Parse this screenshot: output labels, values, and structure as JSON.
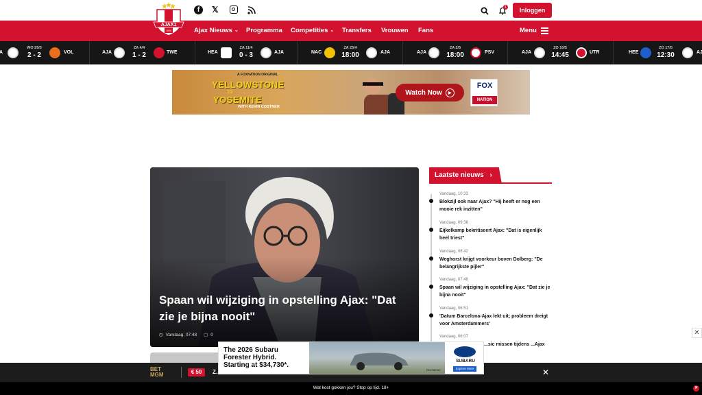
{
  "header": {
    "social": [
      "facebook-icon",
      "x-icon",
      "instagram-icon",
      "rss-icon"
    ],
    "notification_count": "1",
    "login_label": "Inloggen"
  },
  "logo": {
    "text": "AJAX1",
    "subtext": "1900"
  },
  "nav": {
    "items": [
      "Ajax Nieuws",
      "Programma",
      "Competities",
      "Transfers",
      "Vrouwen",
      "Fans"
    ],
    "menu_label": "Menu"
  },
  "scores": [
    {
      "home": "A",
      "away": "VOL",
      "date": "WO 25/3",
      "result": "2 - 2"
    },
    {
      "home": "AJA",
      "away": "TWE",
      "date": "ZA 4/4",
      "result": "1 - 2"
    },
    {
      "home": "HEA",
      "away": "AJA",
      "date": "ZA 11/4",
      "result": "0 - 3"
    },
    {
      "home": "NAC",
      "away": "AJA",
      "date": "ZA 25/4",
      "result": "18:00"
    },
    {
      "home": "AJA",
      "away": "PSV",
      "date": "ZA 2/5",
      "result": "18:00"
    },
    {
      "home": "AJA",
      "away": "UTR",
      "date": "ZO 10/5",
      "result": "14:45"
    },
    {
      "home": "HEE",
      "away": "AJ",
      "date": "ZO 17/5",
      "result": "12:30"
    }
  ],
  "banner_ad": {
    "brand": "A FOXNATION ORIGINAL",
    "line1": "YELLOWSTONE",
    "line2": "TO",
    "line3": "YOSEMITE",
    "line4": "WITH KEVIN COSTNER",
    "cta": "Watch Now",
    "logo_top": "FOX",
    "logo_bottom": "NATION"
  },
  "hero": {
    "title": "Spaan wil wijziging in opstelling Ajax: \"Dat zie je bijna nooit\"",
    "time": "Vandaag, 07:48",
    "comments": "0"
  },
  "latest": {
    "heading": "Laatste nieuws",
    "items": [
      {
        "time": "Vandaag, 10:33",
        "title": "Blokzijl ook naar Ajax? \"Hij heeft er nog een mooie rek inzitten\""
      },
      {
        "time": "Vandaag, 09:38",
        "title": "Eijkelkamp bekritiseert Ajax: \"Dat is eigenlijk heel triest\""
      },
      {
        "time": "Vandaag, 08:42",
        "title": "Weghorst krijgt voorkeur boven Dolberg: \"De belangrijkste pijler\""
      },
      {
        "time": "Vandaag, 07:48",
        "title": "Spaan wil wijziging in opstelling Ajax: \"Dat zie je bijna nooit\""
      },
      {
        "time": "Vandaag, 06:51",
        "title": "'Datum Barcelona-Ajax lekt uit; probleem dreigt voor Amsterdammers'"
      },
      {
        "time": "Vandaag, 06:07",
        "title": "...sic missen tijdens ...Ajax"
      }
    ]
  },
  "subaru_ad": {
    "copy_l1": "The 2026 Subaru",
    "copy_l2": "Forester Hybrid.",
    "copy_l3": "Starting at $34,730*.",
    "brand": "SUBARU",
    "cta": "Explore More",
    "disclaimer": "Disclaimer"
  },
  "bet_bar": {
    "brand_top": "BET",
    "brand_bottom": "MGM",
    "bonus": "€ 50",
    "text": "Z..."
  },
  "footer": {
    "text": "Wat kost gokken jou? Stop op tijd. 18+"
  },
  "colors": {
    "brand_red": "#d2122e",
    "dark": "#161616"
  }
}
